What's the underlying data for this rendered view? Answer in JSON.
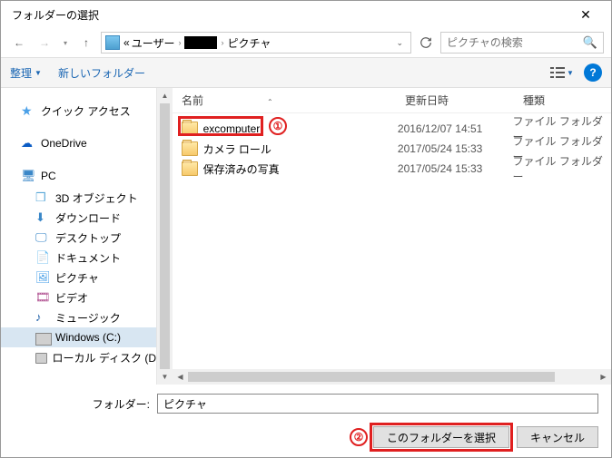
{
  "title": "フォルダーの選択",
  "breadcrumb": {
    "sep1": "«",
    "seg1": "ユーザー",
    "seg3": "ピクチャ"
  },
  "search": {
    "placeholder": "ピクチャの検索"
  },
  "toolbar": {
    "organize": "整理",
    "newfolder": "新しいフォルダー"
  },
  "columns": {
    "name": "名前",
    "date": "更新日時",
    "type": "種類"
  },
  "sidebar": {
    "quick": "クイック アクセス",
    "onedrive": "OneDrive",
    "pc": "PC",
    "obj3d": "3D オブジェクト",
    "downloads": "ダウンロード",
    "desktop": "デスクトップ",
    "documents": "ドキュメント",
    "pictures": "ピクチャ",
    "videos": "ビデオ",
    "music": "ミュージック",
    "windows": "Windows (C:)",
    "localdisk": "ローカル ディスク (D"
  },
  "rows": [
    {
      "name": "excomputer",
      "date": "2016/12/07 14:51",
      "type": "ファイル フォルダー"
    },
    {
      "name": "カメラ ロール",
      "date": "2017/05/24 15:33",
      "type": "ファイル フォルダー"
    },
    {
      "name": "保存済みの写真",
      "date": "2017/05/24 15:33",
      "type": "ファイル フォルダー"
    }
  ],
  "folder": {
    "label": "フォルダー:",
    "value": "ピクチャ"
  },
  "buttons": {
    "select": "このフォルダーを選択",
    "cancel": "キャンセル"
  },
  "annot": {
    "one": "①",
    "two": "②"
  }
}
